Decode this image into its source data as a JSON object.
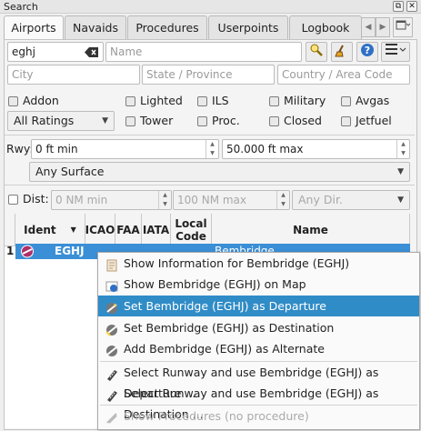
{
  "window": {
    "title": "Search"
  },
  "tabs": [
    "Airports",
    "Navaids",
    "Procedures",
    "Userpoints",
    "Logbook"
  ],
  "search": {
    "ident_value": "eghj",
    "name_placeholder": "Name",
    "city_placeholder": "City",
    "state_placeholder": "State / Province",
    "country_placeholder": "Country / Area Code"
  },
  "filters": {
    "addon": "Addon",
    "lighted": "Lighted",
    "ils": "ILS",
    "military": "Military",
    "avgas": "Avgas",
    "ratings": "All Ratings",
    "tower": "Tower",
    "proc": "Proc.",
    "closed": "Closed",
    "jetfuel": "Jetfuel"
  },
  "runway": {
    "label": "Rwy:",
    "min": "0 ft min",
    "max": "50.000 ft max",
    "surface": "Any Surface"
  },
  "distance": {
    "label": "Dist:",
    "min": "0 NM min",
    "max": "100 NM max",
    "direction": "Any Dir."
  },
  "table": {
    "columns": [
      "Ident",
      "ICAO",
      "FAA",
      "IATA",
      "Local Code",
      "Name"
    ],
    "rows": [
      {
        "num": "1",
        "ident": "EGHJ",
        "name": "Bembridge"
      }
    ]
  },
  "context_menu": {
    "items": [
      {
        "label": "Show Information for Bembridge (EGHJ)",
        "icon": "info-icon"
      },
      {
        "label": "Show Bembridge (EGHJ) on Map",
        "icon": "map-icon"
      },
      {
        "label": "Set Bembridge (EGHJ) as Departure",
        "icon": "departure-icon"
      },
      {
        "label": "Set Bembridge (EGHJ) as Destination",
        "icon": "destination-icon"
      },
      {
        "label": "Add Bembridge (EGHJ) as Alternate",
        "icon": "alternate-icon"
      },
      {
        "label": "Select Runway and use Bembridge (EGHJ) as Departure ...",
        "icon": "runway-departure-icon"
      },
      {
        "label": "Select Runway and use Bembridge (EGHJ) as Destination ...",
        "icon": "runway-destination-icon"
      },
      {
        "label": "Show Procedures (no procedure)",
        "icon": "procedures-icon"
      }
    ]
  },
  "colors": {
    "selection": "#308cc6",
    "row_highlight": "#3a8fd6"
  }
}
